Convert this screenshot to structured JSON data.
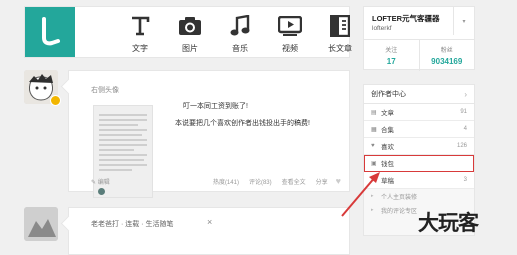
{
  "toolbar": {
    "logo_letter": "L",
    "actions": [
      {
        "label": "文字",
        "icon": "text-icon"
      },
      {
        "label": "图片",
        "icon": "camera-icon"
      },
      {
        "label": "音乐",
        "icon": "music-note-icon"
      },
      {
        "label": "视频",
        "icon": "video-play-icon"
      },
      {
        "label": "长文章",
        "icon": "long-article-icon"
      }
    ]
  },
  "feed": [
    {
      "author": "右侧头像",
      "text_line_1": "叮一本同工资到账了!",
      "text_line_2": "本说要把几个喜欢创作者出钱投出手的稿费!",
      "footer": {
        "edit": "✎ 编辑",
        "stats": [
          "热度(141)",
          "评论(83)",
          "查看全文",
          "分享"
        ]
      }
    },
    {
      "author": "老老爸打",
      "tags": "· 连载 · 生活随笔",
      "close": "×"
    }
  ],
  "profile": {
    "name": "LOFTER元气客疆器",
    "sub": "lofterkf",
    "dropdown": "▾",
    "stats": [
      {
        "label": "关注",
        "value": "17"
      },
      {
        "label": "粉丝",
        "value": "9034169"
      }
    ]
  },
  "creator_center": {
    "title": "创作者中心",
    "chevron": "›",
    "items": [
      {
        "icon": "document-icon",
        "label": "文章",
        "count": "91"
      },
      {
        "icon": "collection-icon",
        "label": "合集",
        "count": "4"
      },
      {
        "icon": "heart-icon",
        "label": "喜欢",
        "count": "126"
      },
      {
        "icon": "wallet-icon",
        "label": "钱包",
        "count": ""
      },
      {
        "icon": "draft-icon",
        "label": "草稿",
        "count": "3"
      }
    ],
    "sub_items": [
      {
        "label": "个人主页装修"
      },
      {
        "label": "我的评论专区"
      }
    ]
  },
  "watermark": "大玩客",
  "colors": {
    "brand": "#23a79b",
    "highlight": "#d83a3a"
  }
}
